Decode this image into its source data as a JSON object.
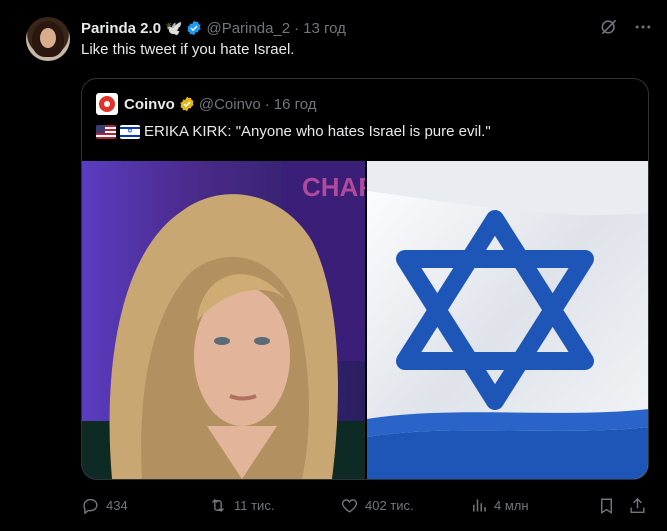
{
  "tweet": {
    "author_name": "Parinda 2.0",
    "author_emoji": "🕊️",
    "handle": "@Parinda_2",
    "separator": "·",
    "time": "13 год",
    "text": "Like this tweet if you hate Israel."
  },
  "quote": {
    "author_name": "Coinvo",
    "handle": "@Coinvo",
    "separator": "·",
    "time": "16 год",
    "text": "ERIKA KIRK: \"Anyone who hates Israel is pure evil.\"",
    "left_image_backdrop_text": "CHARL KIRK"
  },
  "actions": {
    "replies": "434",
    "reposts": "11 тис.",
    "likes": "402 тис.",
    "views": "4 млн"
  },
  "colors": {
    "background": "#000000",
    "text": "#e7e9ea",
    "muted": "#71767b",
    "verified_blue": "#1d9bf0",
    "verified_gold": "#e2b719",
    "border": "#2f3336"
  }
}
